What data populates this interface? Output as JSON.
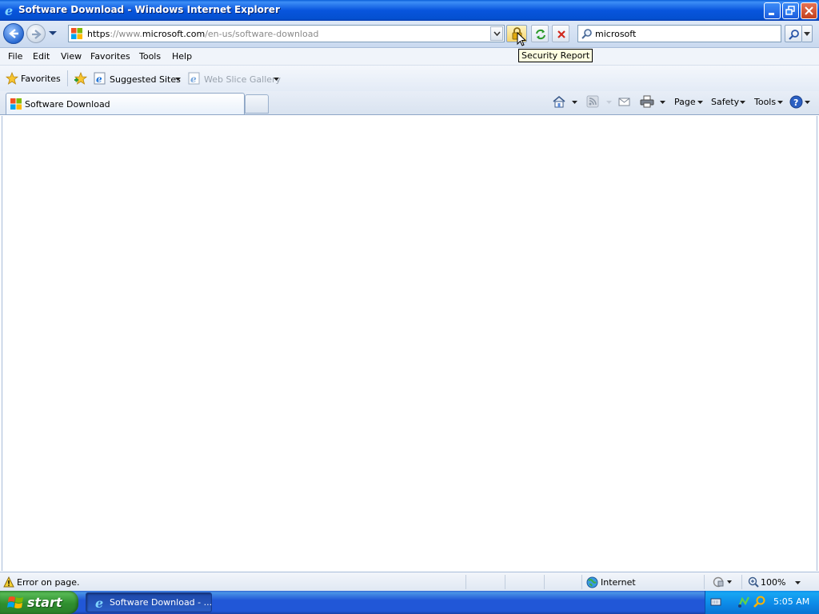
{
  "window": {
    "title": "Software Download - Windows Internet Explorer",
    "buttons": [
      "minimize",
      "restore",
      "close"
    ]
  },
  "address_bar": {
    "url_protocol": "https",
    "url_sep": "://www.",
    "url_domain": "microsoft.com",
    "url_path": "/en-us/software-download"
  },
  "search": {
    "value": "microsoft"
  },
  "tooltip": {
    "text": "Security Report"
  },
  "menu": {
    "items": [
      "File",
      "Edit",
      "View",
      "Favorites",
      "Tools",
      "Help"
    ]
  },
  "favorites_bar": {
    "favorites_label": "Favorites",
    "suggested_sites": "Suggested Sites",
    "web_slice_gallery": "Web Slice Gallery"
  },
  "tabs": {
    "active_label": "Software Download"
  },
  "command_bar": {
    "page": "Page",
    "safety": "Safety",
    "tools": "Tools"
  },
  "status_bar": {
    "message": "Error on page.",
    "zone": "Internet",
    "zoom": "100%"
  },
  "taskbar": {
    "start_label": "start",
    "task_item": "Software Download - ...",
    "clock": "5:05 AM"
  },
  "colors": {
    "title_bar": "#0855dd",
    "taskbar": "#2157d7",
    "start_button": "#3c9a3c",
    "tooltip_bg": "#ffffe1"
  }
}
